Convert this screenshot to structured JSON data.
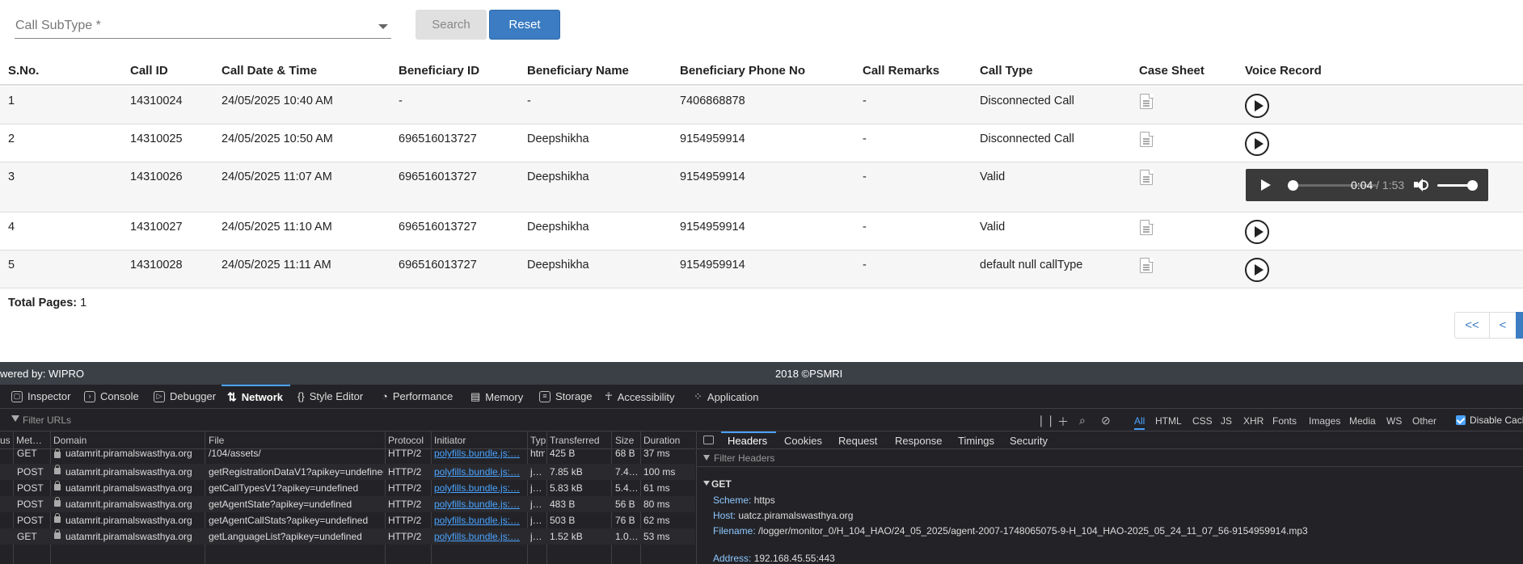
{
  "filter": {
    "call_subtype_label": "Call SubType *"
  },
  "buttons": {
    "search": "Search",
    "reset": "Reset"
  },
  "table": {
    "headers": [
      "S.No.",
      "Call ID",
      "Call Date & Time",
      "Beneficiary ID",
      "Beneficiary Name",
      "Beneficiary Phone No",
      "Call Remarks",
      "Call Type",
      "Case Sheet",
      "Voice Record"
    ],
    "rows": [
      {
        "sno": "1",
        "call_id": "14310024",
        "datetime": "24/05/2025 10:40 AM",
        "ben_id": "-",
        "ben_name": "-",
        "phone": "7406868878",
        "remarks": "-",
        "call_type": "Disconnected Call"
      },
      {
        "sno": "2",
        "call_id": "14310025",
        "datetime": "24/05/2025 10:50 AM",
        "ben_id": "696516013727",
        "ben_name": "Deepshikha",
        "phone": "9154959914",
        "remarks": "-",
        "call_type": "Disconnected Call"
      },
      {
        "sno": "3",
        "call_id": "14310026",
        "datetime": "24/05/2025 11:07 AM",
        "ben_id": "696516013727",
        "ben_name": "Deepshikha",
        "phone": "9154959914",
        "remarks": "-",
        "call_type": "Valid"
      },
      {
        "sno": "4",
        "call_id": "14310027",
        "datetime": "24/05/2025 11:10 AM",
        "ben_id": "696516013727",
        "ben_name": "Deepshikha",
        "phone": "9154959914",
        "remarks": "-",
        "call_type": "Valid"
      },
      {
        "sno": "5",
        "call_id": "14310028",
        "datetime": "24/05/2025 11:11 AM",
        "ben_id": "696516013727",
        "ben_name": "Deepshikha",
        "phone": "9154959914",
        "remarks": "-",
        "call_type": "default null callType"
      }
    ]
  },
  "audio_player": {
    "current": "0:04",
    "separator": " / ",
    "total": "1:53",
    "progress_fraction": 0.035,
    "volume_fraction": 1.0
  },
  "pagination": {
    "total_pages_label": "Total Pages:",
    "total_pages_value": "1",
    "first": "<<",
    "prev": "<"
  },
  "footer": {
    "powered_by": "wered by: WIPRO",
    "copyright": "2018 ©PSMRI"
  },
  "devtools": {
    "tabs": [
      {
        "label": "Inspector",
        "icon": "inspector-icon"
      },
      {
        "label": "Console",
        "icon": "console-icon"
      },
      {
        "label": "Debugger",
        "icon": "debugger-icon"
      },
      {
        "label": "Network",
        "icon": "network-icon"
      },
      {
        "label": "Style Editor",
        "icon": "style-editor-icon"
      },
      {
        "label": "Performance",
        "icon": "performance-icon"
      },
      {
        "label": "Memory",
        "icon": "memory-icon"
      },
      {
        "label": "Storage",
        "icon": "storage-icon"
      },
      {
        "label": "Accessibility",
        "icon": "accessibility-icon"
      },
      {
        "label": "Application",
        "icon": "application-icon"
      }
    ],
    "filter_placeholder": "Filter URLs",
    "type_filters": [
      "All",
      "HTML",
      "CSS",
      "JS",
      "XHR",
      "Fonts",
      "Images",
      "Media",
      "WS",
      "Other"
    ],
    "disable_cache": "Disable Cach",
    "columns": [
      "us",
      "Met…",
      "Domain",
      "File",
      "Protocol",
      "Initiator",
      "Typ",
      "Transferred",
      "Size",
      "Duration"
    ],
    "requests": [
      {
        "method": "GET",
        "domain": "uatamrit.piramalswasthya.org",
        "file": "/104/assets/",
        "protocol": "HTTP/2",
        "initiator": "polyfills.bundle.js:…",
        "type": "htm",
        "transferred": "425 B",
        "size": "68 B",
        "duration": "37 ms"
      },
      {
        "method": "POST",
        "domain": "uatamrit.piramalswasthya.org",
        "file": "getRegistrationDataV1?apikey=undefined",
        "protocol": "HTTP/2",
        "initiator": "polyfills.bundle.js:…",
        "type": "j…",
        "transferred": "7.85 kB",
        "size": "7.4…",
        "duration": "100 ms"
      },
      {
        "method": "POST",
        "domain": "uatamrit.piramalswasthya.org",
        "file": "getCallTypesV1?apikey=undefined",
        "protocol": "HTTP/2",
        "initiator": "polyfills.bundle.js:…",
        "type": "j…",
        "transferred": "5.83 kB",
        "size": "5.4…",
        "duration": "61 ms"
      },
      {
        "method": "POST",
        "domain": "uatamrit.piramalswasthya.org",
        "file": "getAgentState?apikey=undefined",
        "protocol": "HTTP/2",
        "initiator": "polyfills.bundle.js:…",
        "type": "j…",
        "transferred": "483 B",
        "size": "56 B",
        "duration": "80 ms"
      },
      {
        "method": "POST",
        "domain": "uatamrit.piramalswasthya.org",
        "file": "getAgentCallStats?apikey=undefined",
        "protocol": "HTTP/2",
        "initiator": "polyfills.bundle.js:…",
        "type": "j…",
        "transferred": "503 B",
        "size": "76 B",
        "duration": "62 ms"
      },
      {
        "method": "GET",
        "domain": "uatamrit.piramalswasthya.org",
        "file": "getLanguageList?apikey=undefined",
        "protocol": "HTTP/2",
        "initiator": "polyfills.bundle.js:…",
        "type": "j…",
        "transferred": "1.52 kB",
        "size": "1.0…",
        "duration": "53 ms"
      }
    ],
    "side_tabs": [
      "Headers",
      "Cookies",
      "Request",
      "Response",
      "Timings",
      "Security"
    ],
    "side_filter_placeholder": "Filter Headers",
    "get_section": "GET",
    "details": [
      {
        "key": "Scheme:",
        "value": "https"
      },
      {
        "key": "Host:",
        "value": "uatcz.piramalswasthya.org"
      },
      {
        "key": "Filename:",
        "value": "/logger/monitor_0/H_104_HAO/24_05_2025/agent-2007-1748065075-9-H_104_HAO-2025_05_24_11_07_56-9154959914.mp3"
      },
      {
        "key": "Address:",
        "value": "192.168.45.55:443"
      }
    ]
  }
}
